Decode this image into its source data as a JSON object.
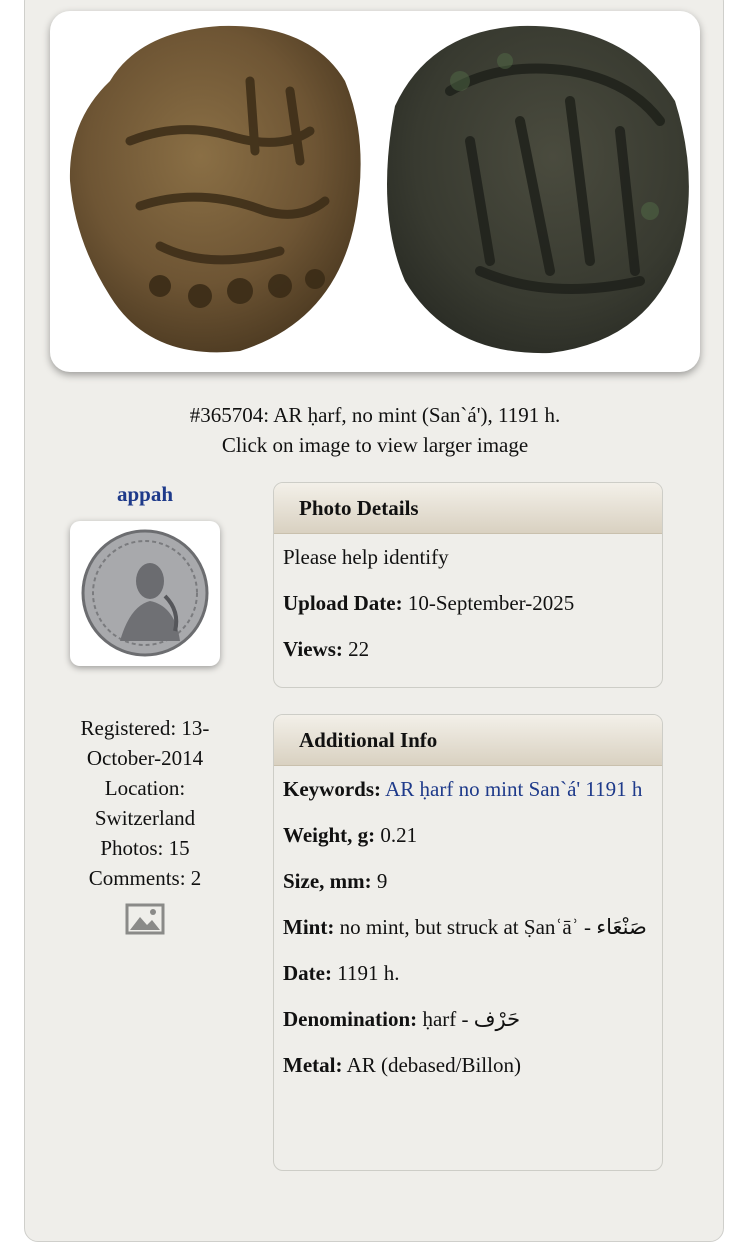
{
  "photo": {
    "caption_title": "#365704: AR ḥarf, no mint (San`á'), 1191 h.",
    "caption_hint": "Click on image to view larger image"
  },
  "user": {
    "name": "appah",
    "registered": "Registered: 13-October-2014",
    "location": "Location: Switzerland",
    "photos": "Photos: 15",
    "comments": "Comments: 2"
  },
  "photo_details": {
    "heading": "Photo Details",
    "description": "Please help identify",
    "upload_date_label": "Upload Date:",
    "upload_date": "10-September-2025",
    "views_label": "Views:",
    "views": "22"
  },
  "additional_info": {
    "heading": "Additional Info",
    "keywords_label": "Keywords:",
    "keywords": "AR ḥarf no mint San`á' 1191 h",
    "weight_label": "Weight, g:",
    "weight": "0.21",
    "size_label": "Size, mm:",
    "size": "9",
    "mint_label": "Mint:",
    "mint": "no mint, but struck at Ṣanʿāʾ - صَنْعَاء",
    "date_label": "Date:",
    "date": "1191 h.",
    "denomination_label": "Denomination:",
    "denomination": "ḥarf - حَرْف",
    "metal_label": "Metal:",
    "metal": "AR (debased/Billon)"
  },
  "icons": {
    "gallery": "image-gallery-icon"
  }
}
